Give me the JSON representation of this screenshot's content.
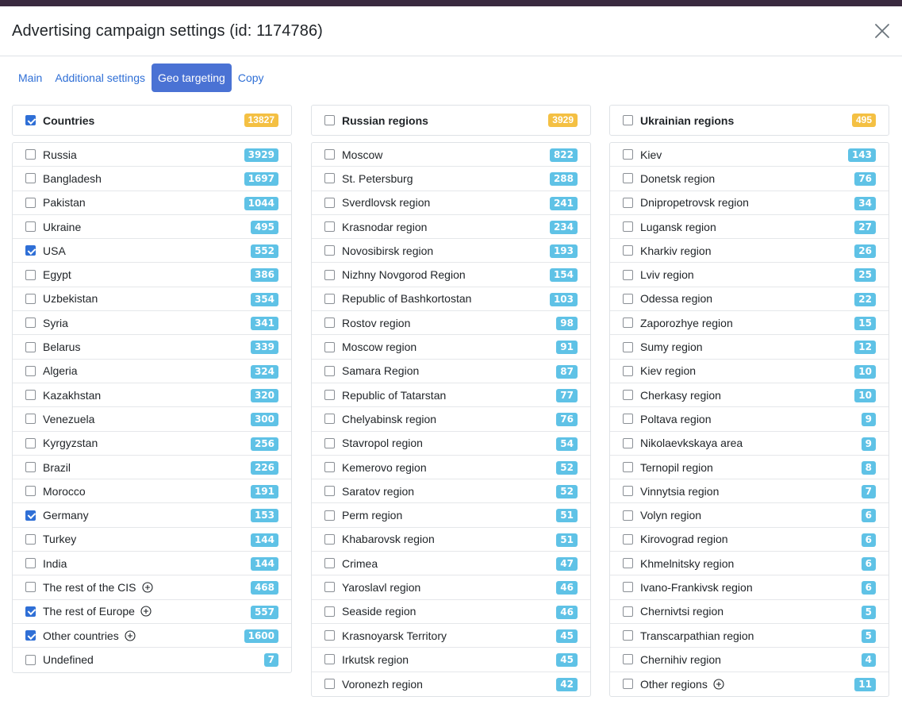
{
  "modal": {
    "title": "Advertising campaign settings (id: 1174786)"
  },
  "tabs": [
    {
      "label": "Main",
      "active": false
    },
    {
      "label": "Additional settings",
      "active": false
    },
    {
      "label": "Geo targeting",
      "active": true
    },
    {
      "label": "Copy",
      "active": false
    }
  ],
  "colors": {
    "accent": "#4a72d4",
    "link": "#2f6fd6",
    "badge_info": "#5fc2e6",
    "badge_warning": "#f4c043"
  },
  "columns": [
    {
      "header": {
        "label": "Countries",
        "count": "13827",
        "checked": true
      },
      "items": [
        {
          "name": "Russia",
          "count": "3929",
          "checked": false,
          "expand": false
        },
        {
          "name": "Bangladesh",
          "count": "1697",
          "checked": false,
          "expand": false
        },
        {
          "name": "Pakistan",
          "count": "1044",
          "checked": false,
          "expand": false
        },
        {
          "name": "Ukraine",
          "count": "495",
          "checked": false,
          "expand": false
        },
        {
          "name": "USA",
          "count": "552",
          "checked": true,
          "expand": false
        },
        {
          "name": "Egypt",
          "count": "386",
          "checked": false,
          "expand": false
        },
        {
          "name": "Uzbekistan",
          "count": "354",
          "checked": false,
          "expand": false
        },
        {
          "name": "Syria",
          "count": "341",
          "checked": false,
          "expand": false
        },
        {
          "name": "Belarus",
          "count": "339",
          "checked": false,
          "expand": false
        },
        {
          "name": "Algeria",
          "count": "324",
          "checked": false,
          "expand": false
        },
        {
          "name": "Kazakhstan",
          "count": "320",
          "checked": false,
          "expand": false
        },
        {
          "name": "Venezuela",
          "count": "300",
          "checked": false,
          "expand": false
        },
        {
          "name": "Kyrgyzstan",
          "count": "256",
          "checked": false,
          "expand": false
        },
        {
          "name": "Brazil",
          "count": "226",
          "checked": false,
          "expand": false
        },
        {
          "name": "Morocco",
          "count": "191",
          "checked": false,
          "expand": false
        },
        {
          "name": "Germany",
          "count": "153",
          "checked": true,
          "expand": false
        },
        {
          "name": "Turkey",
          "count": "144",
          "checked": false,
          "expand": false
        },
        {
          "name": "India",
          "count": "144",
          "checked": false,
          "expand": false
        },
        {
          "name": "The rest of the CIS",
          "count": "468",
          "checked": false,
          "expand": true
        },
        {
          "name": "The rest of Europe",
          "count": "557",
          "checked": true,
          "expand": true
        },
        {
          "name": "Other countries",
          "count": "1600",
          "checked": true,
          "expand": true
        },
        {
          "name": "Undefined",
          "count": "7",
          "checked": false,
          "expand": false
        }
      ]
    },
    {
      "header": {
        "label": "Russian regions",
        "count": "3929",
        "checked": false
      },
      "items": [
        {
          "name": "Moscow",
          "count": "822",
          "checked": false,
          "expand": false
        },
        {
          "name": "St. Petersburg",
          "count": "288",
          "checked": false,
          "expand": false
        },
        {
          "name": "Sverdlovsk region",
          "count": "241",
          "checked": false,
          "expand": false
        },
        {
          "name": "Krasnodar region",
          "count": "234",
          "checked": false,
          "expand": false
        },
        {
          "name": "Novosibirsk region",
          "count": "193",
          "checked": false,
          "expand": false
        },
        {
          "name": "Nizhny Novgorod Region",
          "count": "154",
          "checked": false,
          "expand": false
        },
        {
          "name": "Republic of Bashkortostan",
          "count": "103",
          "checked": false,
          "expand": false
        },
        {
          "name": "Rostov region",
          "count": "98",
          "checked": false,
          "expand": false
        },
        {
          "name": "Moscow region",
          "count": "91",
          "checked": false,
          "expand": false
        },
        {
          "name": "Samara Region",
          "count": "87",
          "checked": false,
          "expand": false
        },
        {
          "name": "Republic of Tatarstan",
          "count": "77",
          "checked": false,
          "expand": false
        },
        {
          "name": "Chelyabinsk region",
          "count": "76",
          "checked": false,
          "expand": false
        },
        {
          "name": "Stavropol region",
          "count": "54",
          "checked": false,
          "expand": false
        },
        {
          "name": "Kemerovo region",
          "count": "52",
          "checked": false,
          "expand": false
        },
        {
          "name": "Saratov region",
          "count": "52",
          "checked": false,
          "expand": false
        },
        {
          "name": "Perm region",
          "count": "51",
          "checked": false,
          "expand": false
        },
        {
          "name": "Khabarovsk region",
          "count": "51",
          "checked": false,
          "expand": false
        },
        {
          "name": "Crimea",
          "count": "47",
          "checked": false,
          "expand": false
        },
        {
          "name": "Yaroslavl region",
          "count": "46",
          "checked": false,
          "expand": false
        },
        {
          "name": "Seaside region",
          "count": "46",
          "checked": false,
          "expand": false
        },
        {
          "name": "Krasnoyarsk Territory",
          "count": "45",
          "checked": false,
          "expand": false
        },
        {
          "name": "Irkutsk region",
          "count": "45",
          "checked": false,
          "expand": false
        },
        {
          "name": "Voronezh region",
          "count": "42",
          "checked": false,
          "expand": false
        }
      ]
    },
    {
      "header": {
        "label": "Ukrainian regions",
        "count": "495",
        "checked": false
      },
      "items": [
        {
          "name": "Kiev",
          "count": "143",
          "checked": false,
          "expand": false
        },
        {
          "name": "Donetsk region",
          "count": "76",
          "checked": false,
          "expand": false
        },
        {
          "name": "Dnipropetrovsk region",
          "count": "34",
          "checked": false,
          "expand": false
        },
        {
          "name": "Lugansk region",
          "count": "27",
          "checked": false,
          "expand": false
        },
        {
          "name": "Kharkiv region",
          "count": "26",
          "checked": false,
          "expand": false
        },
        {
          "name": "Lviv region",
          "count": "25",
          "checked": false,
          "expand": false
        },
        {
          "name": "Odessa region",
          "count": "22",
          "checked": false,
          "expand": false
        },
        {
          "name": "Zaporozhye region",
          "count": "15",
          "checked": false,
          "expand": false
        },
        {
          "name": "Sumy region",
          "count": "12",
          "checked": false,
          "expand": false
        },
        {
          "name": "Kiev region",
          "count": "10",
          "checked": false,
          "expand": false
        },
        {
          "name": "Cherkasy region",
          "count": "10",
          "checked": false,
          "expand": false
        },
        {
          "name": "Poltava region",
          "count": "9",
          "checked": false,
          "expand": false
        },
        {
          "name": "Nikolaevkskaya area",
          "count": "9",
          "checked": false,
          "expand": false
        },
        {
          "name": "Ternopil region",
          "count": "8",
          "checked": false,
          "expand": false
        },
        {
          "name": "Vinnytsia region",
          "count": "7",
          "checked": false,
          "expand": false
        },
        {
          "name": "Volyn region",
          "count": "6",
          "checked": false,
          "expand": false
        },
        {
          "name": "Kirovograd region",
          "count": "6",
          "checked": false,
          "expand": false
        },
        {
          "name": "Khmelnitsky region",
          "count": "6",
          "checked": false,
          "expand": false
        },
        {
          "name": "Ivano-Frankivsk region",
          "count": "6",
          "checked": false,
          "expand": false
        },
        {
          "name": "Chernivtsi region",
          "count": "5",
          "checked": false,
          "expand": false
        },
        {
          "name": "Transcarpathian region",
          "count": "5",
          "checked": false,
          "expand": false
        },
        {
          "name": "Chernihiv region",
          "count": "4",
          "checked": false,
          "expand": false
        },
        {
          "name": "Other regions",
          "count": "11",
          "checked": false,
          "expand": true
        }
      ]
    }
  ]
}
